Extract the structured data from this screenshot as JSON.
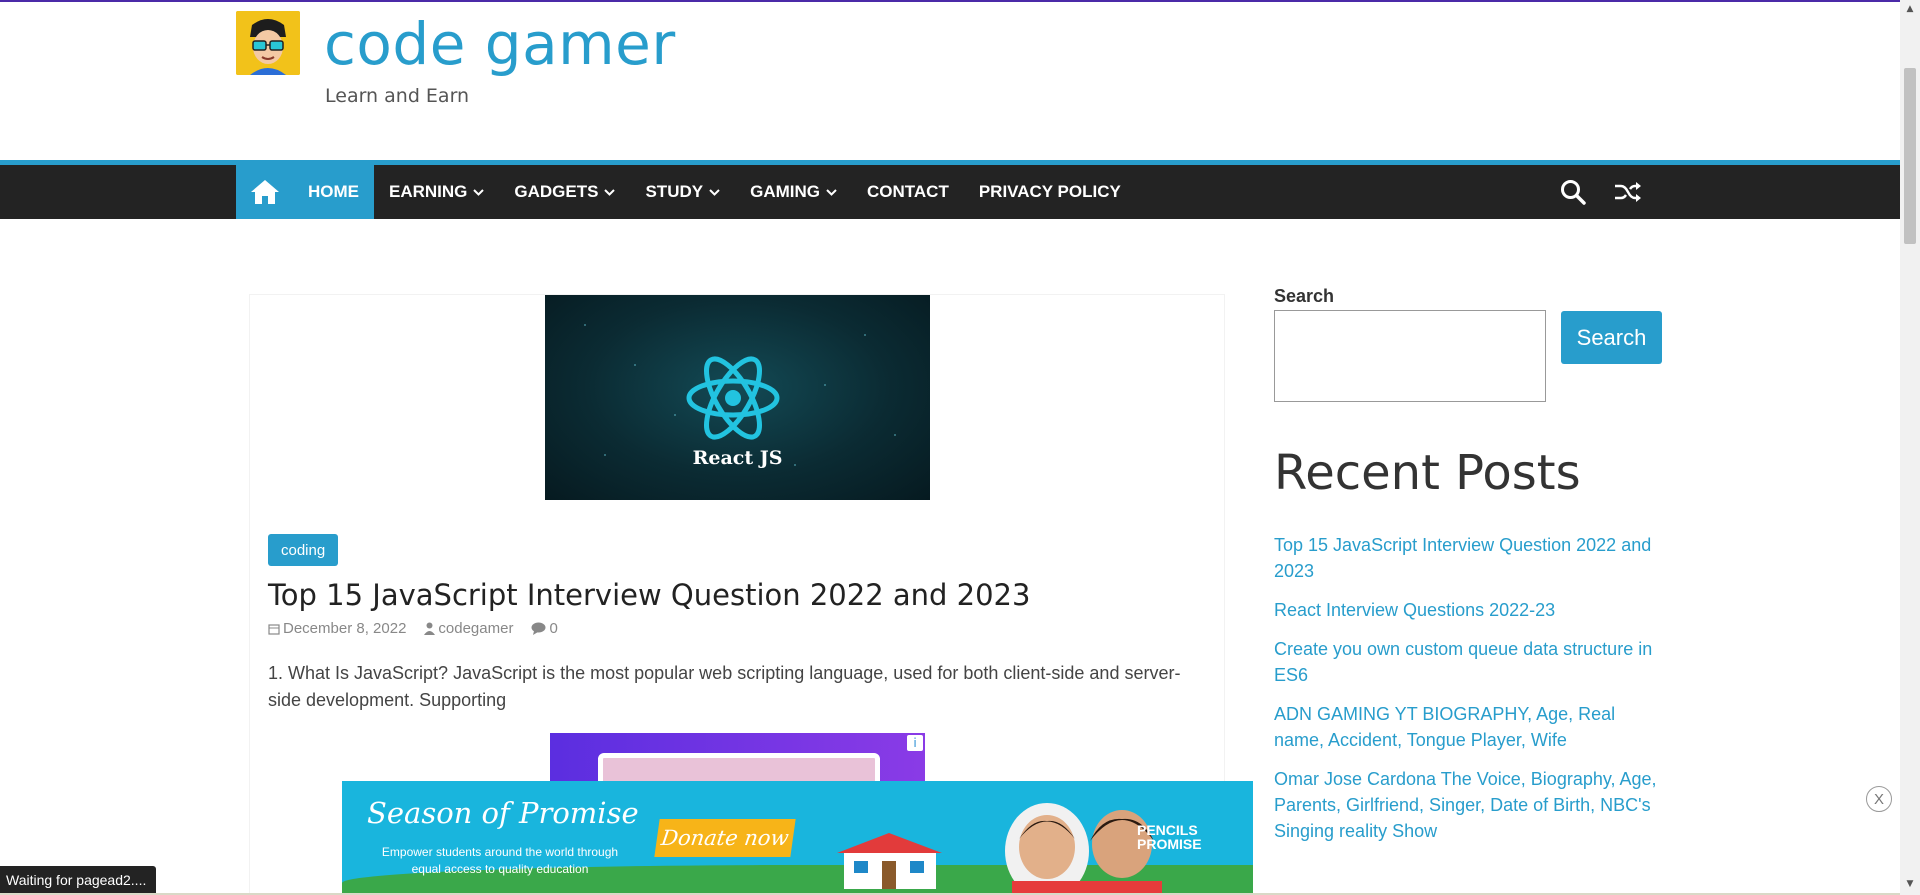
{
  "site": {
    "title": "code gamer",
    "tagline": "Learn and Earn"
  },
  "nav": {
    "items": [
      {
        "label": "HOME",
        "active": true,
        "has_dropdown": false
      },
      {
        "label": "EARNING",
        "active": false,
        "has_dropdown": true
      },
      {
        "label": "GADGETS",
        "active": false,
        "has_dropdown": true
      },
      {
        "label": "STUDY",
        "active": false,
        "has_dropdown": true
      },
      {
        "label": "GAMING",
        "active": false,
        "has_dropdown": true
      },
      {
        "label": "CONTACT",
        "active": false,
        "has_dropdown": false
      },
      {
        "label": "PRIVACY POLICY",
        "active": false,
        "has_dropdown": false
      }
    ],
    "icons": [
      "home-icon",
      "search-icon",
      "random-icon"
    ]
  },
  "post": {
    "featured_caption": "React JS",
    "category": "coding",
    "title": "Top 15 JavaScript Interview Question 2022 and 2023",
    "date": "December 8, 2022",
    "author": "codegamer",
    "comments": "0",
    "excerpt": "1. What Is JavaScript? JavaScript is the most popular web scripting language, used for both client-side and server-side development. Supporting"
  },
  "sidebar": {
    "search_label": "Search",
    "search_button": "Search",
    "search_value": "",
    "recent_title": "Recent Posts",
    "recent_posts": [
      "Top 15 JavaScript Interview Question 2022 and 2023",
      "React Interview Questions 2022-23",
      "Create you own custom queue data structure in ES6",
      "ADN GAMING YT BIOGRAPHY, Age, Real name, Accident, Tongue Player, Wife",
      "Omar Jose Cardona The Voice, Biography, Age, Parents, Girlfriend, Singer, Date of Birth, NBC's Singing reality Show"
    ]
  },
  "ad": {
    "headline": "Season of Promise",
    "subtext": "Empower students around the world through equal access to quality education",
    "button": "Donate now",
    "brand_line1": "PENCILS",
    "brand_line2": "PROMISE",
    "close_label": "X",
    "info_label": "i"
  },
  "status": {
    "text": "Waiting for pagead2...."
  },
  "colors": {
    "accent": "#289dcc",
    "nav_bg": "#232323",
    "ad_bg": "#19b5dd",
    "donate": "#f7b418"
  }
}
